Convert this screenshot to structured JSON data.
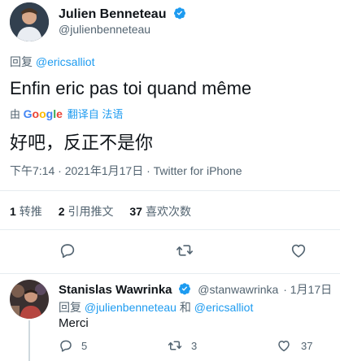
{
  "tweet": {
    "author_name": "Julien Benneteau",
    "author_handle": "@julienbenneteau",
    "reply_prefix": "回复",
    "reply_to": "@ericsalliot",
    "text": "Enfin eric pas toi quand même",
    "translation_by": "由",
    "translation_brand": "Google",
    "translation_label": "翻译自 法语",
    "translated_text": "好吧，反正不是你",
    "timestamp": "下午7:14 · 2021年1月17日 · Twitter for iPhone",
    "stats": [
      {
        "count": "1",
        "label": "转推"
      },
      {
        "count": "2",
        "label": "引用推文"
      },
      {
        "count": "37",
        "label": "喜欢次数"
      }
    ],
    "actions": [
      "reply-icon",
      "retweet-icon",
      "like-icon",
      "share-icon"
    ]
  },
  "reply": {
    "author_name": "Stanislas Wawrinka",
    "author_handle": "@stanwawrinka",
    "date": "· 1月17日",
    "reply_prefix": "回复",
    "reply_to_1": "@julienbenneteau",
    "reply_and": "和",
    "reply_to_2": "@ericsalliot",
    "text": "Merci",
    "reply_count": "5",
    "retweet_count": "3",
    "like_count": "37"
  },
  "colors": {
    "accent": "#1d9bf0",
    "google_blue": "#4285f4",
    "google_red": "#ea4335",
    "google_yellow": "#fbbc05",
    "google_green": "#34a853"
  }
}
